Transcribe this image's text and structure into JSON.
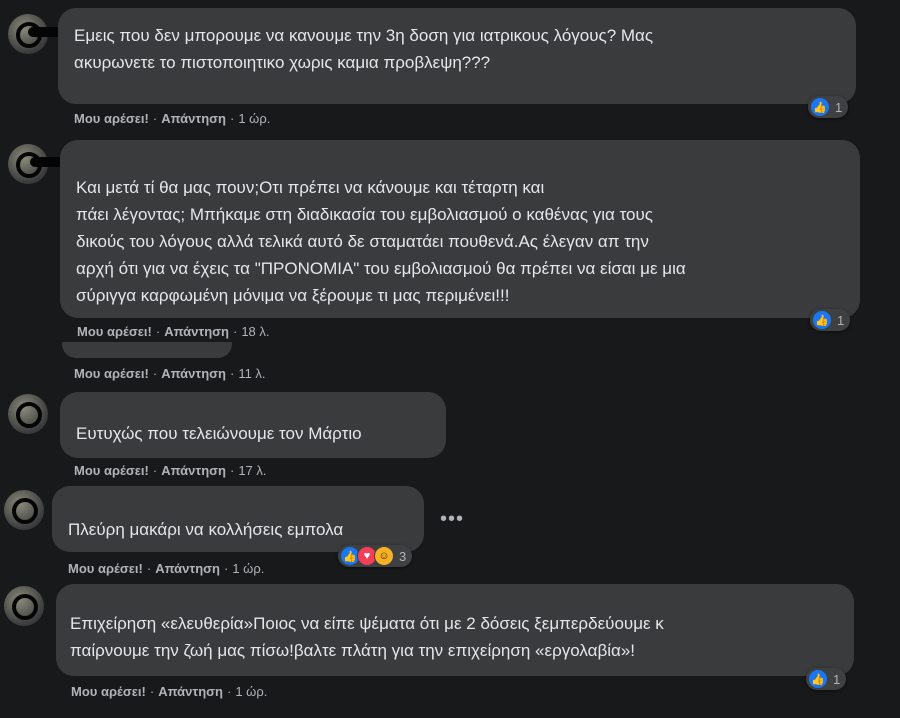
{
  "colors": {
    "background": "#18191a",
    "bubble": "#3a3b3c",
    "text": "#e4e6eb",
    "meta": "#b0b3b8",
    "like": "#1877f2"
  },
  "labels": {
    "like": "Μου αρέσει!",
    "reply": "Απάντηση",
    "sep": "·"
  },
  "comments": [
    {
      "text": "Εμεις που δεν μπορουμε να κανουμε την 3η δοση για ιατρικους λόγους? Μας\nακυρωνετε το πιστοποιητικο χωρις καμια προβλεψη???",
      "time": "1 ώρ.",
      "reactions": {
        "icons": [
          "like-icon"
        ],
        "count": "1"
      }
    },
    {
      "text": "Και μετά τί θα μας πουν;Οτι πρέπει να κάνουμε και τέταρτη και\nπάει λέγοντας; Μπήκαμε στη διαδικασία του εμβολιασμού ο καθένας για τους\nδικούς του λόγους αλλά τελικά αυτό δε σταματάει πουθενά.Ας έλεγαν απ την\nαρχή ότι για να έχεις τα \"ΠΡΟΝΟΜΙΑ\" του εμβολιασμού θα πρέπει να είσαι με μια\nσύριγγα καρφωμένη μόνιμα να ξέρουμε τι μας περιμένει!!!",
      "time": "18 λ.",
      "reactions": {
        "icons": [
          "like-icon"
        ],
        "count": "1"
      }
    },
    {
      "text": "",
      "time": "11 λ."
    },
    {
      "text": "Ευτυχώς που τελειώνουμε τον Μάρτιο",
      "time": "17 λ."
    },
    {
      "text": "Πλεύρη μακάρι να κολλήσεις εμπολα",
      "time": "1 ώρ.",
      "reactions": {
        "icons": [
          "like-icon",
          "love-icon",
          "haha-icon"
        ],
        "count": "3"
      },
      "more": "•••"
    },
    {
      "text": "Επιχείρηση «ελευθερία»Ποιος να είπε ψέματα ότι με 2 δόσεις ξεμπερδεύουμε κ\nπαίρνουμε την ζωή μας πίσω!βαλτε πλάτη για την επιχείρηση «εργολαβία»!",
      "time": "1 ώρ.",
      "reactions": {
        "icons": [
          "like-icon"
        ],
        "count": "1"
      }
    }
  ]
}
